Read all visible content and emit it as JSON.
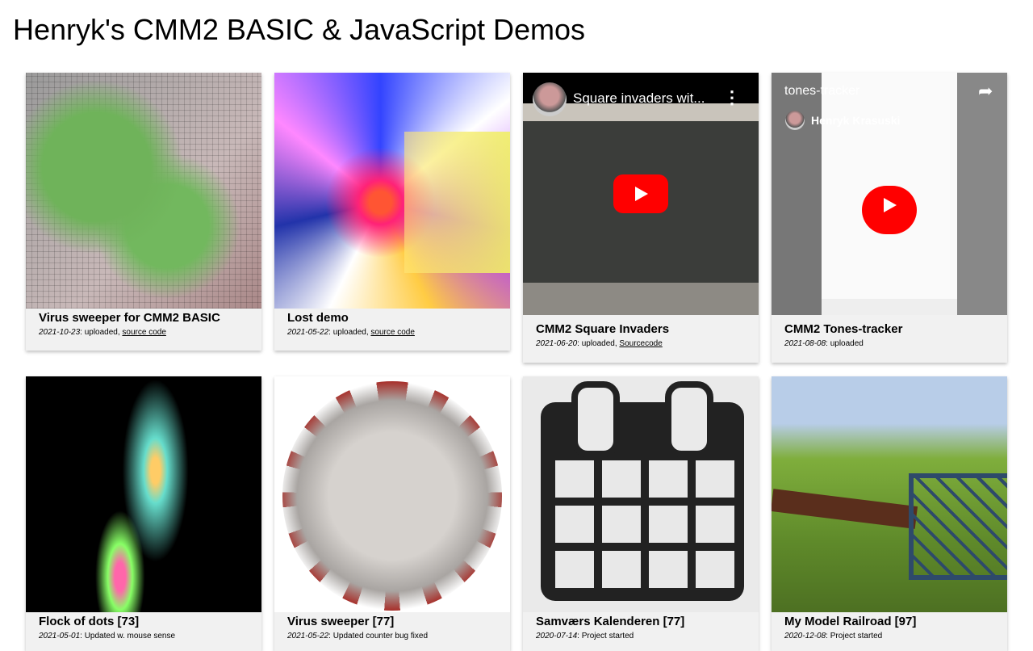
{
  "page_title": "Henryk's CMM2 BASIC & JavaScript Demos",
  "cards": [
    {
      "title": "Virus sweeper for CMM2 BASIC",
      "date": "2021-10-23",
      "note": ": uploaded, ",
      "link": "source code"
    },
    {
      "title": "Lost demo",
      "date": "2021-05-22",
      "note": ": uploaded, ",
      "link": "source code"
    },
    {
      "title": "CMM2 Square Invaders",
      "date": "2021-06-20",
      "note": ": uploaded, ",
      "link": "Sourcecode",
      "video_title": "Square invaders wit...",
      "video_menu": "⋮"
    },
    {
      "title": "CMM2 Tones-tracker",
      "date": "2021-08-08",
      "note": ": uploaded",
      "video_title": "tones-tracker",
      "video_channel": "Henryk Krasuski",
      "video_share": "➦"
    },
    {
      "title": "Flock of dots [73]",
      "date": "2021-05-01",
      "note": ": Updated w. mouse sense"
    },
    {
      "title": "Virus sweeper [77]",
      "date": "2021-05-22",
      "note": ": Updated counter bug fixed"
    },
    {
      "title": "Samværs Kalenderen [77]",
      "date": "2020-07-14",
      "note": ": Project started"
    },
    {
      "title": "My Model Railroad [97]",
      "date": "2020-12-08",
      "note": ": Project started"
    }
  ],
  "colors": {
    "youtube_red": "#ff0000",
    "card_bg": "#f1f1f1"
  }
}
